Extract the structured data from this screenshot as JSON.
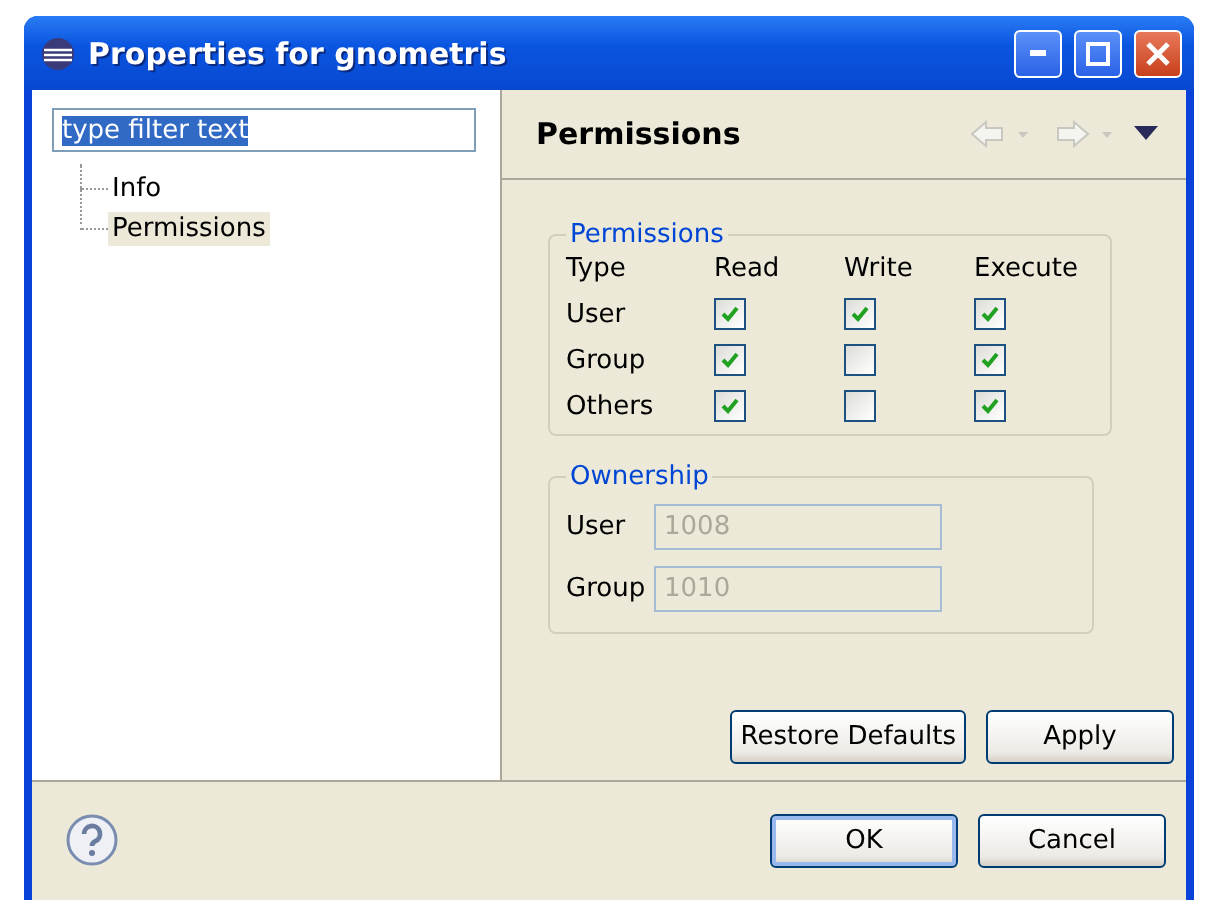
{
  "window": {
    "title": "Properties for gnometris"
  },
  "filter": {
    "value": "type filter text",
    "text_selected": true
  },
  "tree": [
    {
      "label": "Info",
      "selected": false
    },
    {
      "label": "Permissions",
      "selected": true
    }
  ],
  "page": {
    "title": "Permissions"
  },
  "permissions": {
    "title": "Permissions",
    "columns": [
      "Type",
      "Read",
      "Write",
      "Execute"
    ],
    "rows": [
      {
        "label": "User",
        "checks": [
          {
            "checked": true
          },
          {
            "checked": true
          },
          {
            "checked": true
          }
        ]
      },
      {
        "label": "Group",
        "checks": [
          {
            "checked": true
          },
          {
            "checked": false
          },
          {
            "checked": true
          }
        ]
      },
      {
        "label": "Others",
        "checks": [
          {
            "checked": true
          },
          {
            "checked": false
          },
          {
            "checked": true
          }
        ]
      }
    ]
  },
  "ownership": {
    "title": "Ownership",
    "fields": [
      {
        "label": "User",
        "value": "1008",
        "disabled": true
      },
      {
        "label": "Group",
        "value": "1010",
        "disabled": true
      }
    ]
  },
  "page_buttons": [
    "Restore Defaults",
    "Apply"
  ],
  "dialog_buttons": [
    {
      "label": "OK",
      "default": true
    },
    {
      "label": "Cancel",
      "default": false
    }
  ]
}
